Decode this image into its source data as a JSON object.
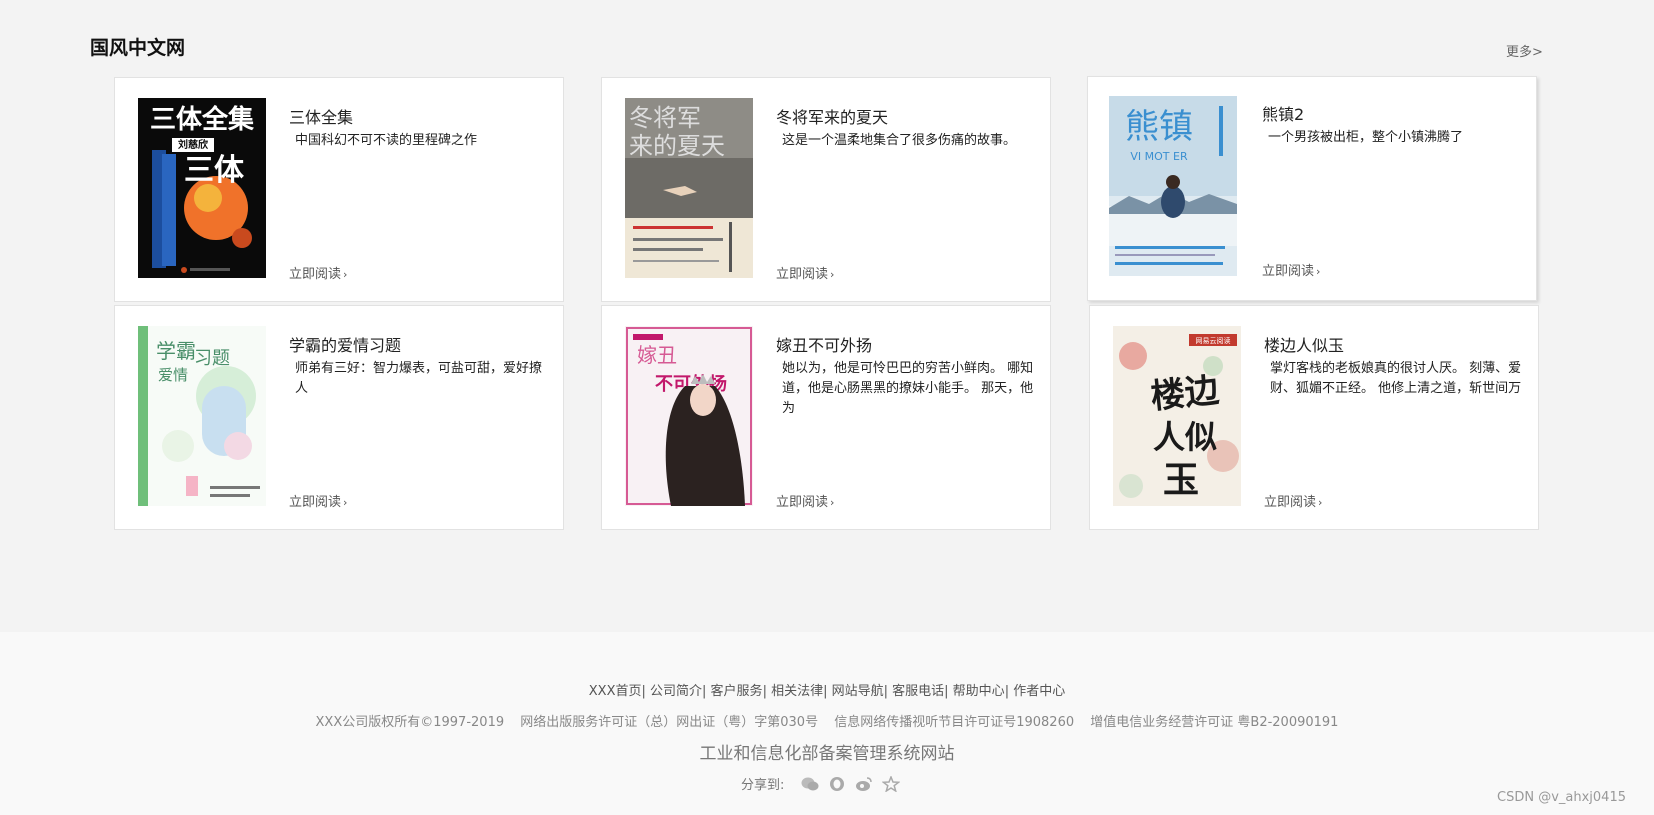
{
  "section": {
    "title": "国风中文网",
    "more": "更多>"
  },
  "books": [
    {
      "title": "三体全集",
      "desc": "中国科幻不可不读的里程碑之作",
      "read": "立即阅读",
      "cover_text": [
        "三体全集",
        "三体",
        "刘慈欣"
      ]
    },
    {
      "title": "冬将军来的夏天",
      "desc": "这是一个温柔地集合了很多伤痛的故事。",
      "read": "立即阅读",
      "cover_text": [
        "冬将军",
        "来的夏天"
      ]
    },
    {
      "title": "熊镇2",
      "desc": "一个男孩被出柜，整个小镇沸腾了",
      "read": "立即阅读",
      "cover_text": [
        "熊镇",
        "VI MOT ER"
      ]
    },
    {
      "title": "学霸的爱情习题",
      "desc": "师弟有三好：智力爆表，可盐可甜，爱好撩人",
      "read": "立即阅读",
      "cover_text": [
        "学霸",
        "爱情",
        "习题"
      ]
    },
    {
      "title": "嫁丑不可外扬",
      "desc": "她以为，他是可怜巴巴的穷苦小鲜肉。 哪知道，他是心肠黑黑的撩妹小能手。 那天，他为",
      "read": "立即阅读",
      "cover_text": [
        "嫁丑",
        "不可外扬"
      ]
    },
    {
      "title": "楼边人似玉",
      "desc": "掌灯客栈的老板娘真的很讨人厌。 刻薄、爱财、狐媚不正经。 他修上清之道，斩世间万",
      "read": "立即阅读",
      "cover_text": [
        "楼边",
        "人似",
        "玉",
        "网易云阅读"
      ]
    }
  ],
  "footer": {
    "links": [
      "XXX首页",
      "公司简介",
      "客户服务",
      "相关法律",
      "网站导航",
      "客服电话",
      "帮助中心",
      "作者中心"
    ],
    "copyright": [
      "XXX公司版权所有©1997-2019",
      "网络出版服务许可证（总）网出证（粤）字第030号",
      "信息网络传播视听节目许可证号1908260",
      "增值电信业务经营许可证 粤B2-20090191"
    ],
    "icp": "工业和信息化部备案管理系统网站",
    "share_label": "分享到:",
    "share_icons": [
      "wechat-icon",
      "qq-icon",
      "weibo-icon",
      "star-icon"
    ]
  },
  "watermark": "CSDN @v_ahxj0415"
}
